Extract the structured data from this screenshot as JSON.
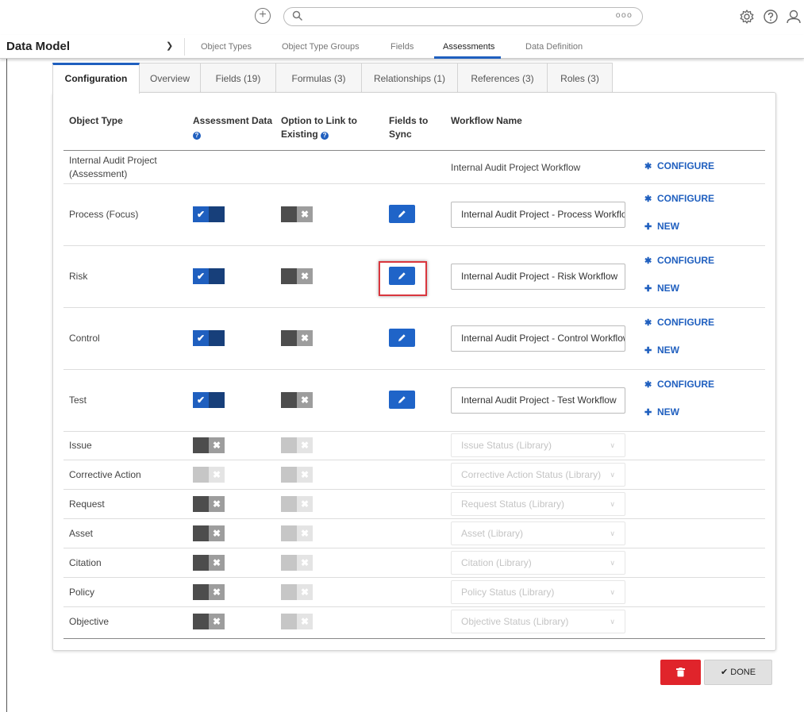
{
  "topbar": {
    "add_icon": "plus-circle-icon",
    "search_icon": "search-icon",
    "search_placeholder": "",
    "more_dots": "ooo",
    "icons": [
      "gear-icon",
      "help-icon",
      "user-icon"
    ]
  },
  "nav": {
    "title": "Data Model",
    "items": [
      "Object Types",
      "Object Type Groups",
      "Fields",
      "Assessments",
      "Data Definition"
    ],
    "active": "Assessments"
  },
  "tabs": [
    "Configuration",
    "Overview",
    "Fields (19)",
    "Formulas (3)",
    "Relationships (1)",
    "References (3)",
    "Roles (3)"
  ],
  "table": {
    "headers": {
      "object_type": "Object Type",
      "assessment_data": "Assessment Data",
      "option_link_1": "Option to Link to",
      "option_link_2": "Existing",
      "fields_sync_1": "Fields to",
      "fields_sync_2": "Sync",
      "workflow_name": "Workflow Name"
    },
    "assessment_row": {
      "object_type_1": "Internal Audit Project",
      "object_type_2": "(Assessment)",
      "workflow_name": "Internal Audit Project Workflow",
      "configure": "CONFIGURE"
    },
    "focus_rows": [
      {
        "object_type": "Process (Focus)",
        "assessment_data": true,
        "link_existing": false,
        "workflow": "Internal Audit Project - Process Workflow",
        "configure": "CONFIGURE",
        "new": "NEW"
      },
      {
        "object_type": "Risk",
        "assessment_data": true,
        "link_existing": false,
        "workflow": "Internal Audit Project - Risk Workflow",
        "configure": "CONFIGURE",
        "new": "NEW"
      },
      {
        "object_type": "Control",
        "assessment_data": true,
        "link_existing": false,
        "workflow": "Internal Audit Project - Control Workflow",
        "configure": "CONFIGURE",
        "new": "NEW"
      },
      {
        "object_type": "Test",
        "assessment_data": true,
        "link_existing": false,
        "workflow": "Internal Audit Project - Test Workflow",
        "configure": "CONFIGURE",
        "new": "NEW"
      }
    ],
    "disabled_rows": [
      {
        "object_type": "Issue",
        "assessment_data": false,
        "assessment_disabled": false,
        "workflow": "Issue Status (Library)"
      },
      {
        "object_type": "Corrective Action",
        "assessment_data": false,
        "assessment_disabled": true,
        "workflow": "Corrective Action Status (Library)"
      },
      {
        "object_type": "Request",
        "assessment_data": false,
        "assessment_disabled": false,
        "workflow": "Request Status (Library)"
      },
      {
        "object_type": "Asset",
        "assessment_data": false,
        "assessment_disabled": false,
        "workflow": "Asset (Library)"
      },
      {
        "object_type": "Citation",
        "assessment_data": false,
        "assessment_disabled": false,
        "workflow": "Citation (Library)"
      },
      {
        "object_type": "Policy",
        "assessment_data": false,
        "assessment_disabled": false,
        "workflow": "Policy Status (Library)"
      },
      {
        "object_type": "Objective",
        "assessment_data": false,
        "assessment_disabled": false,
        "workflow": "Objective Status (Library)"
      }
    ]
  },
  "footer": {
    "delete_icon": "trash-icon",
    "done_label": "DONE",
    "done_icon": "check-icon"
  },
  "colors": {
    "primary": "#1f5fbf",
    "danger": "#e0242b",
    "highlight": "#d9363e"
  }
}
